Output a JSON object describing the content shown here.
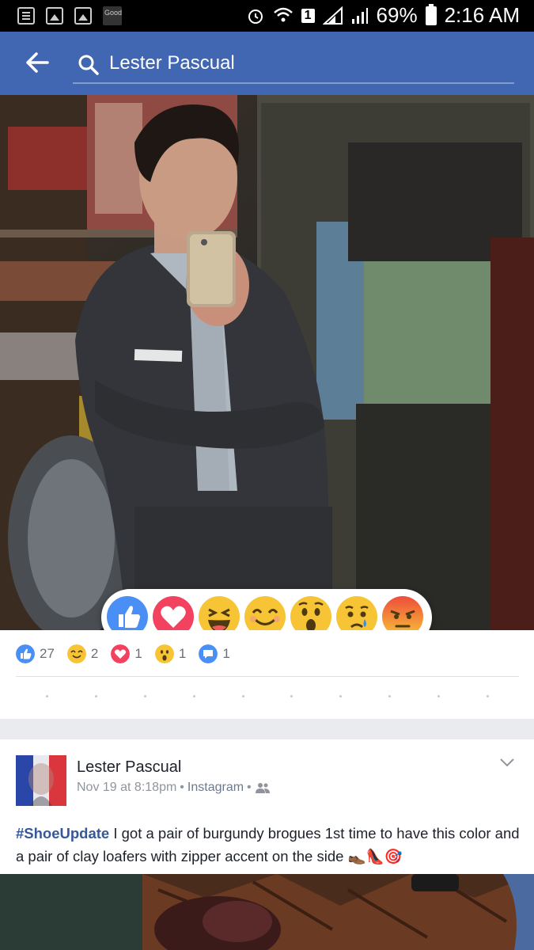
{
  "status_bar": {
    "notification_icons": [
      "list-icon",
      "image-icon",
      "image-icon",
      "good-app-icon"
    ],
    "good_label": "Good",
    "sim_label": "1",
    "battery": "69%",
    "time": "2:16 AM"
  },
  "app_bar": {
    "search_value": "Lester Pascual",
    "accent": "#4267b2"
  },
  "reactions_bar": {
    "items": [
      "like-icon",
      "love-icon",
      "haha-icon",
      "smile-icon",
      "wow-icon",
      "sad-icon",
      "angry-icon"
    ]
  },
  "counts": {
    "like": "27",
    "smile": "2",
    "love": "1",
    "wow": "1",
    "comments": "1"
  },
  "post": {
    "author": "Lester Pascual",
    "date": "Nov 19 at 8:18pm",
    "separator": "•",
    "via": "Instagram",
    "hashtag": "#ShoeUpdate",
    "text": " I got a pair of burgundy brogues 1st time to have this color and a pair of clay loafers with zipper accent on the side",
    "emoji": "👞👠🎯"
  }
}
